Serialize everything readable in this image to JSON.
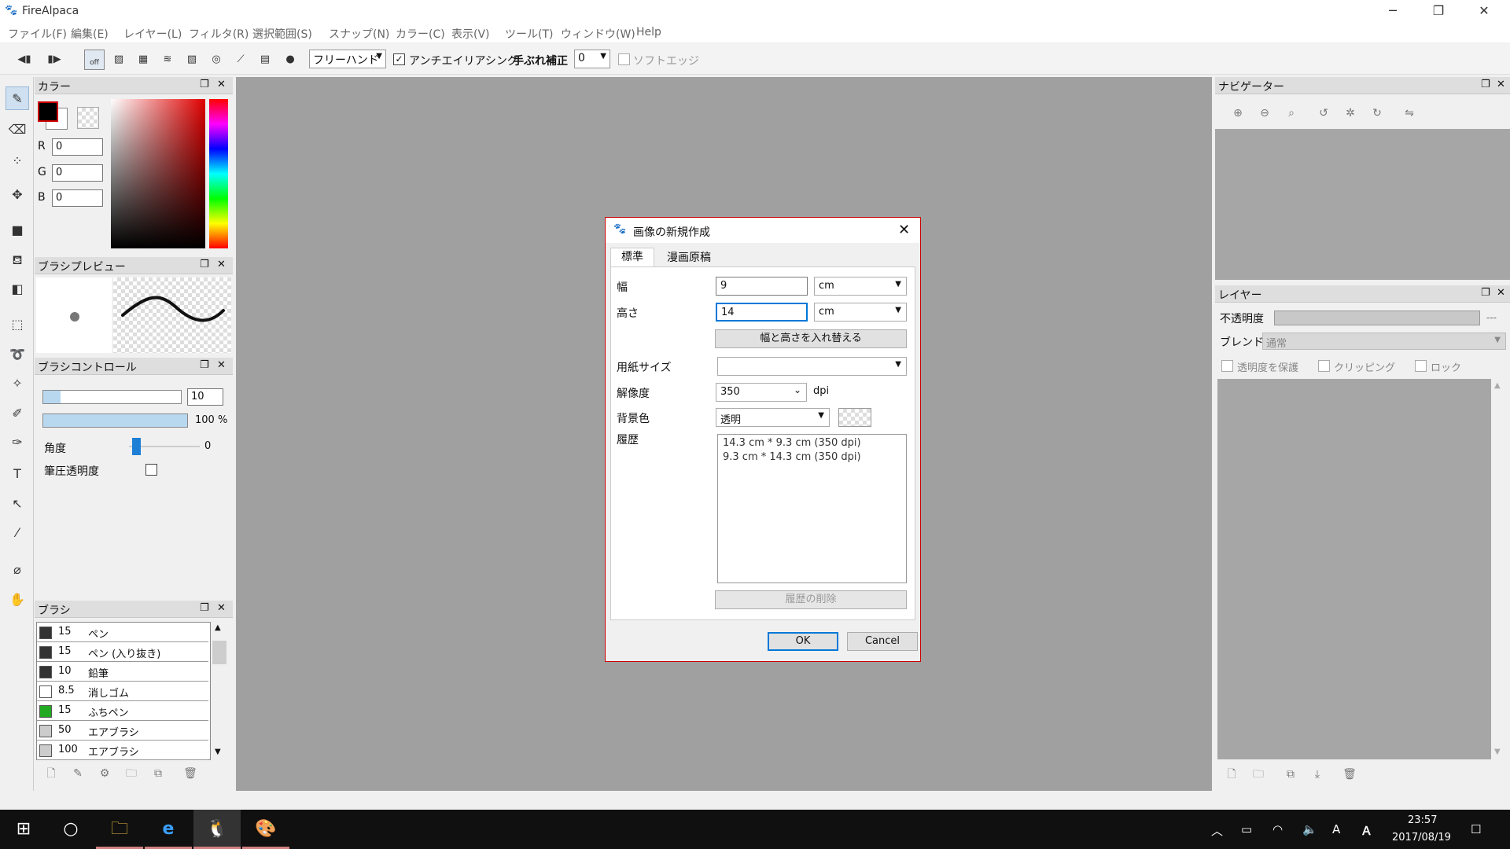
{
  "app": {
    "title": "FireAlpaca"
  },
  "menu": [
    "ファイル(F)",
    "編集(E)",
    "レイヤー(L)",
    "フィルタ(R)",
    "選択範囲(S)",
    "スナップ(N)",
    "カラー(C)",
    "表示(V)",
    "ツール(T)",
    "ウィンドウ(W)",
    "Help"
  ],
  "toolbar": {
    "snap_off": "off",
    "stroke_mode": "フリーハンド",
    "antialias_label": "アンチエイリアシング",
    "antialias_checked": "✓",
    "stabilizer_label": "手ぶれ補正",
    "stabilizer_value": "0",
    "soft_edge_label": "ソフトエッジ"
  },
  "color_panel": {
    "title": "カラー",
    "r_label": "R",
    "g_label": "G",
    "b_label": "B",
    "r": "0",
    "g": "0",
    "b": "0",
    "primary": "#000000"
  },
  "brush_preview": {
    "title": "ブラシプレビュー"
  },
  "brush_control": {
    "title": "ブラシコントロール",
    "size": "10",
    "opacity": "100 %",
    "angle_label": "角度",
    "angle_value": "0",
    "pressure_label": "筆圧透明度"
  },
  "brush_panel": {
    "title": "ブラシ",
    "items": [
      {
        "size": "15",
        "name": "ペン",
        "color": "#333333"
      },
      {
        "size": "15",
        "name": "ペン (入り抜き)",
        "color": "#333333"
      },
      {
        "size": "10",
        "name": "鉛筆",
        "color": "#333333"
      },
      {
        "size": "8.5",
        "name": "消しゴム",
        "color": "#ffffff"
      },
      {
        "size": "15",
        "name": "ふちペン",
        "color": "#22aa22"
      },
      {
        "size": "50",
        "name": "エアブラシ",
        "color": "#cccccc"
      },
      {
        "size": "100",
        "name": "エアブラシ",
        "color": "#cccccc"
      }
    ]
  },
  "navigator": {
    "title": "ナビゲーター"
  },
  "layer_panel": {
    "title": "レイヤー",
    "opacity_label": "不透明度",
    "opacity_value": "---",
    "blend_label": "ブレンド",
    "blend_value": "通常",
    "protect_label": "透明度を保護",
    "clip_label": "クリッピング",
    "lock_label": "ロック"
  },
  "dialog": {
    "title": "画像の新規作成",
    "tab_standard": "標準",
    "tab_manga": "漫画原稿",
    "width_label": "幅",
    "width_value": "9",
    "width_unit": "cm",
    "height_label": "高さ",
    "height_value": "14",
    "height_unit": "cm",
    "swap_button": "幅と高さを入れ替える",
    "paper_label": "用紙サイズ",
    "paper_value": "",
    "dpi_label": "解像度",
    "dpi_value": "350",
    "dpi_unit": "dpi",
    "bg_label": "背景色",
    "bg_value": "透明",
    "history_label": "履歴",
    "history": [
      "14.3 cm * 9.3 cm (350 dpi)",
      "9.3 cm * 14.3 cm (350 dpi)"
    ],
    "clear_history": "履歴の削除",
    "ok": "OK",
    "cancel": "Cancel"
  },
  "taskbar": {
    "time": "23:57",
    "date": "2017/08/19",
    "ime": "A"
  }
}
